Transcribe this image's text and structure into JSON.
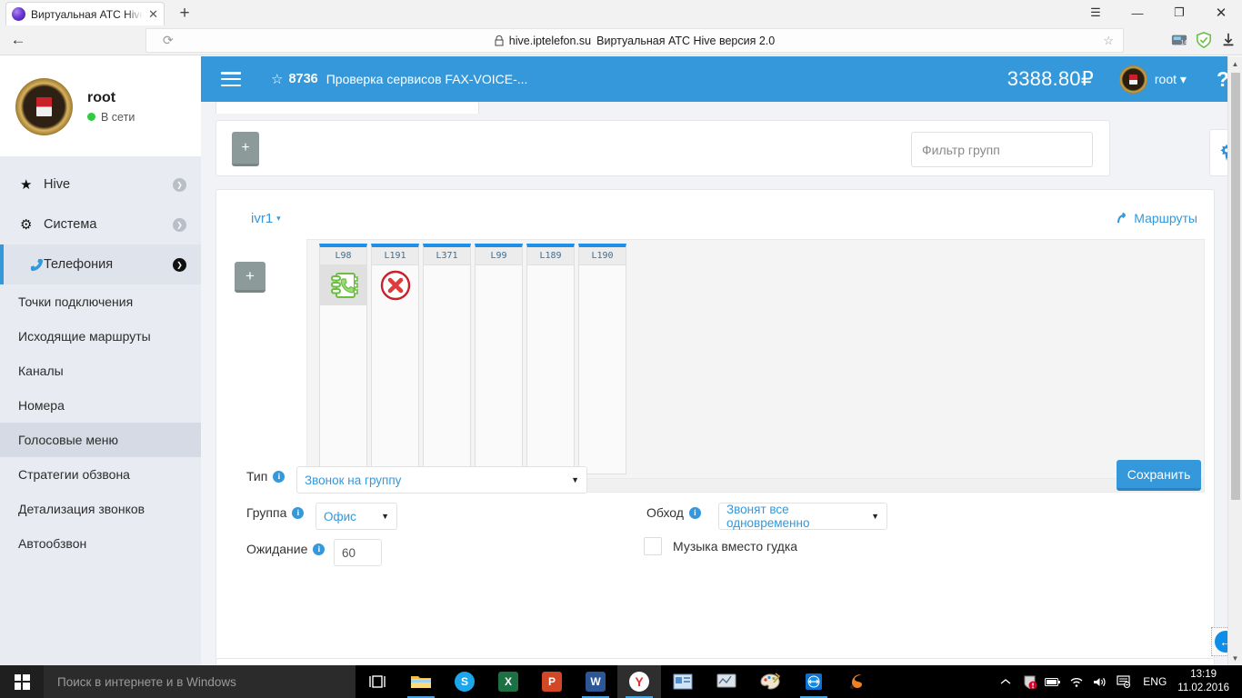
{
  "browser": {
    "tab_title": "Виртуальная АТС Hive ве",
    "tab_close": "✕",
    "new_tab": "+",
    "menu_icon": "☰",
    "minimize": "—",
    "maximize": "❐",
    "close": "✕",
    "back": "←",
    "reload": "⟳",
    "lock": "🔒",
    "url_domain": "hive.iptelefon.su",
    "url_title": "Виртуальная АТС Hive версия 2.0",
    "bookmark_star": "☆"
  },
  "app_header": {
    "star": "☆",
    "ext_number": "8736",
    "description": "Проверка сервисов FAX-VOICE-...",
    "balance": "3388.80₽",
    "user": "root",
    "user_caret": "▾",
    "help": "?"
  },
  "sidebar": {
    "user_name": "root",
    "status": "В сети",
    "items": [
      {
        "label": "Hive",
        "icon": "star-icon",
        "glyph": "★",
        "caret": "❯"
      },
      {
        "label": "Система",
        "icon": "gears-icon",
        "glyph": "⚙",
        "caret": "❯"
      },
      {
        "label": "Телефония",
        "icon": "phone-icon",
        "glyph": "📞",
        "caret": "❯"
      }
    ],
    "subitems": [
      {
        "label": "Точки подключения",
        "selected": false
      },
      {
        "label": "Исходящие маршруты",
        "selected": false
      },
      {
        "label": "Каналы",
        "selected": false
      },
      {
        "label": "Номера",
        "selected": false
      },
      {
        "label": "Голосовые меню",
        "selected": true
      },
      {
        "label": "Стратегии обзвона",
        "selected": false
      },
      {
        "label": "Детализация звонков",
        "selected": false
      },
      {
        "label": "Автообзвон",
        "selected": false
      }
    ]
  },
  "toolbar": {
    "add_group_label": "+",
    "filter_placeholder": "Фильтр групп",
    "filter_value": ""
  },
  "ivr": {
    "name": "ivr1",
    "caret": "▾",
    "routes_label": "Маршруты",
    "routes_icon": "↱",
    "add_node_label": "+",
    "columns": [
      {
        "label": "L98",
        "cell_icon": "phonebook-icon",
        "selected": true
      },
      {
        "label": "L191",
        "cell_icon": "cancel-icon",
        "selected": false
      },
      {
        "label": "L371",
        "cell_icon": "",
        "selected": false
      },
      {
        "label": "L99",
        "cell_icon": "",
        "selected": false
      },
      {
        "label": "L189",
        "cell_icon": "",
        "selected": false
      },
      {
        "label": "L190",
        "cell_icon": "",
        "selected": false
      }
    ],
    "scroll_left": "◀",
    "scroll_right": "▶"
  },
  "form": {
    "type_label": "Тип",
    "type_value": "Звонок на группу",
    "group_label": "Группа",
    "group_value": "Офис",
    "wait_label": "Ожидание",
    "wait_value": "60",
    "bypass_label": "Обход",
    "bypass_value": "Звонят все одновременно",
    "music_label": "Музыка вместо гудка",
    "music_checked": false,
    "save_label": "Сохранить",
    "info_glyph": "i",
    "arrow_glyph": "▼"
  },
  "side_widgets": {
    "settings_icon": "gear-icon",
    "teamviewer_icon": "teamviewer-icon"
  },
  "taskbar": {
    "search_placeholder": "Поиск в интернете и в Windows",
    "apps": [
      {
        "name": "task-view",
        "glyph": "❐",
        "color": "#000000",
        "text": ""
      },
      {
        "name": "file-explorer",
        "glyph": "",
        "color": "#f5c242",
        "text": ""
      },
      {
        "name": "skype",
        "glyph": "S",
        "color": "#1ca7ec",
        "text": "S"
      },
      {
        "name": "excel",
        "glyph": "X",
        "color": "#1d7044",
        "text": "X"
      },
      {
        "name": "powerpoint",
        "glyph": "P",
        "color": "#d24726",
        "text": "P"
      },
      {
        "name": "word",
        "glyph": "W",
        "color": "#2b5797",
        "text": "W"
      },
      {
        "name": "yandex-browser",
        "glyph": "Y",
        "color": "#ffffff",
        "text": "Y"
      },
      {
        "name": "app-window",
        "glyph": "▣",
        "color": "#4a90d9",
        "text": ""
      },
      {
        "name": "monitor-app",
        "glyph": "▤",
        "color": "#b9c4cc",
        "text": ""
      },
      {
        "name": "paint",
        "glyph": "🎨",
        "color": "#e8e0d0",
        "text": ""
      },
      {
        "name": "teamviewer",
        "glyph": "◉",
        "color": "#0e8ee9",
        "text": ""
      },
      {
        "name": "orange-app",
        "glyph": "✦",
        "color": "#f08020",
        "text": ""
      }
    ],
    "tray": [
      {
        "name": "chevron-up-icon",
        "glyph": "︿"
      },
      {
        "name": "security-alert-icon",
        "glyph": "🛡"
      },
      {
        "name": "battery-icon",
        "glyph": "▭"
      },
      {
        "name": "wifi-icon",
        "glyph": "(("
      },
      {
        "name": "volume-icon",
        "glyph": "🔊"
      },
      {
        "name": "action-center-icon",
        "glyph": "🗨"
      }
    ],
    "language": "ENG",
    "time": "13:19",
    "date": "11.02.2016"
  }
}
